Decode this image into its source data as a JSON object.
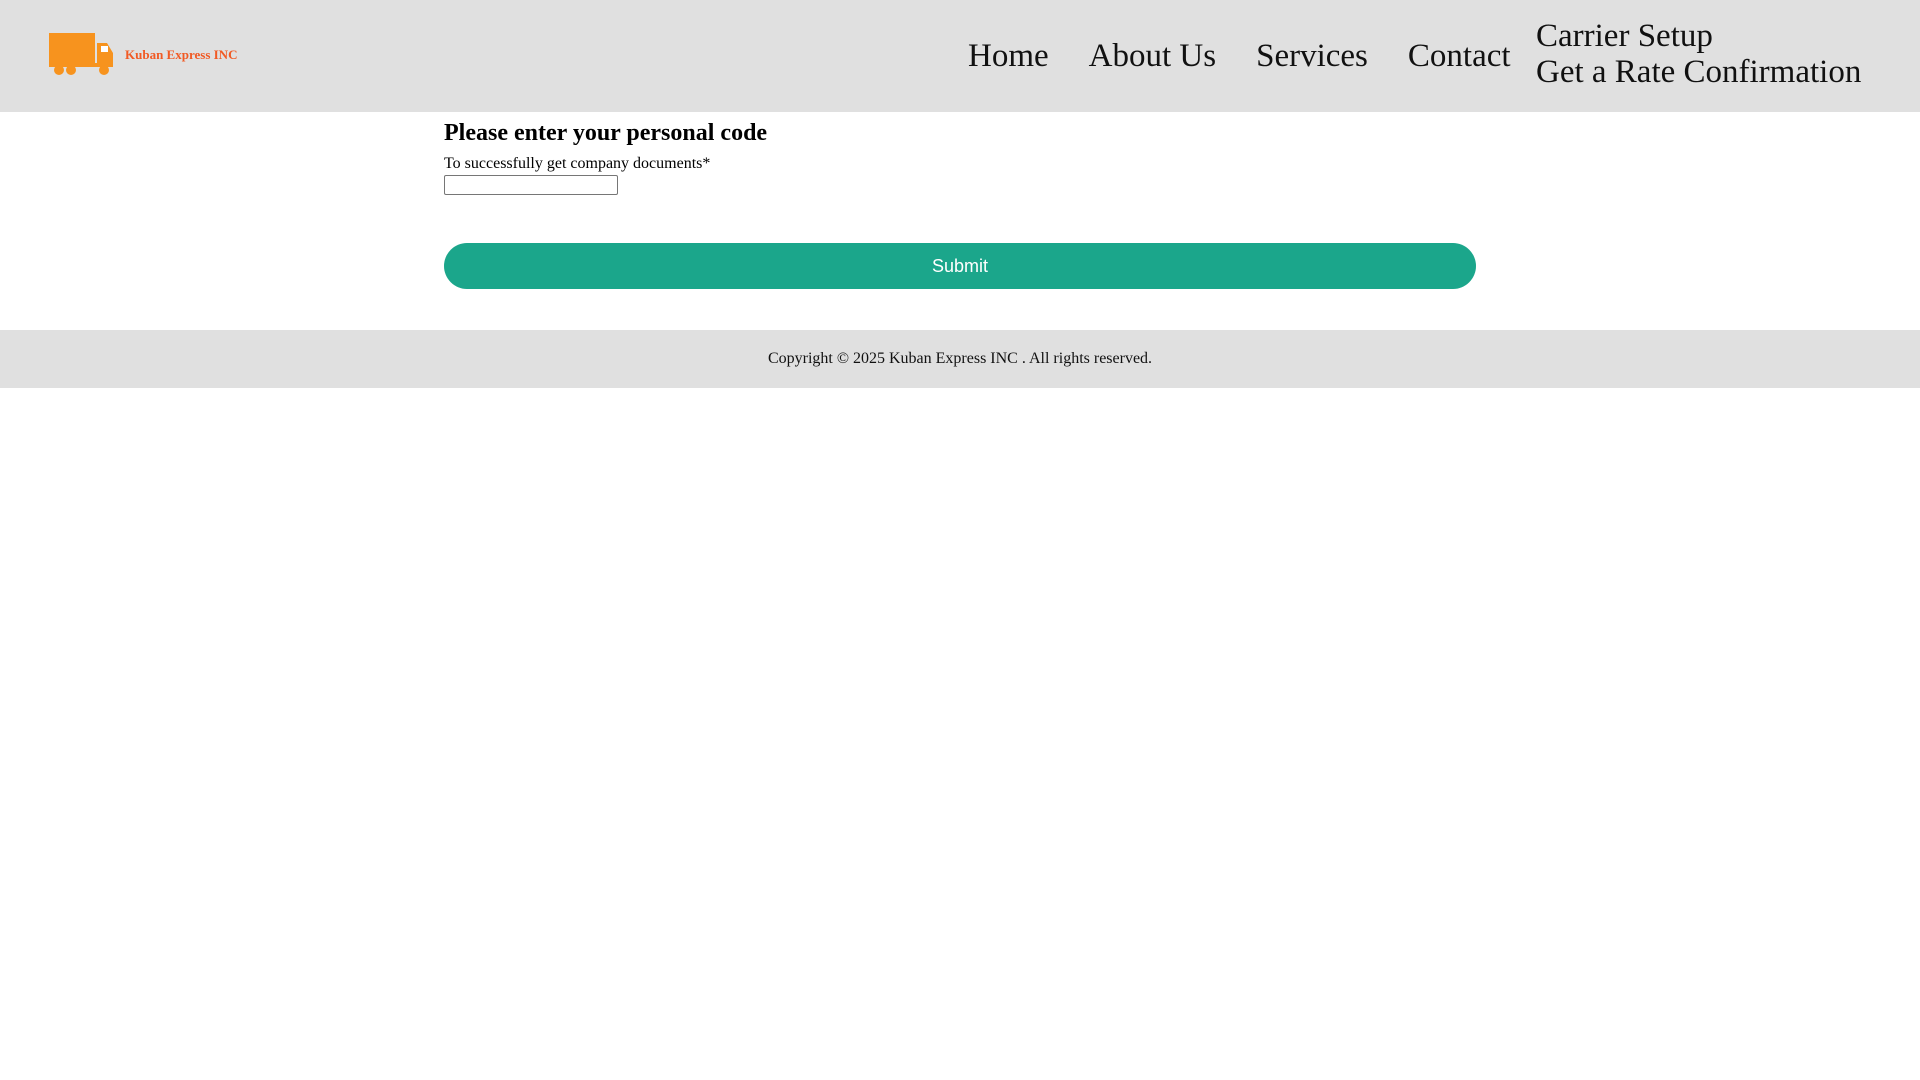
{
  "header": {
    "brand": "Kuban Express INC",
    "logo_icon": "truck-icon",
    "accent_color": "#f7931e",
    "brand_color": "#f15a24",
    "nav": [
      {
        "label": "Home"
      },
      {
        "label": "About Us"
      },
      {
        "label": "Services"
      },
      {
        "label": "Contact"
      }
    ],
    "nav_stack": [
      {
        "label": "Carrier Setup"
      },
      {
        "label": "Get a Rate Confirmation"
      }
    ]
  },
  "form": {
    "title": "Please enter your personal code",
    "label": "To successfully get company documents*",
    "input_value": "",
    "toggle_icon": "eye-icon",
    "toggle_glyph": "",
    "submit_label": "Submit",
    "submit_color": "#1ba68b"
  },
  "footer": {
    "copyright": "Copyright © 2025 Kuban Express INC . All rights reserved."
  }
}
